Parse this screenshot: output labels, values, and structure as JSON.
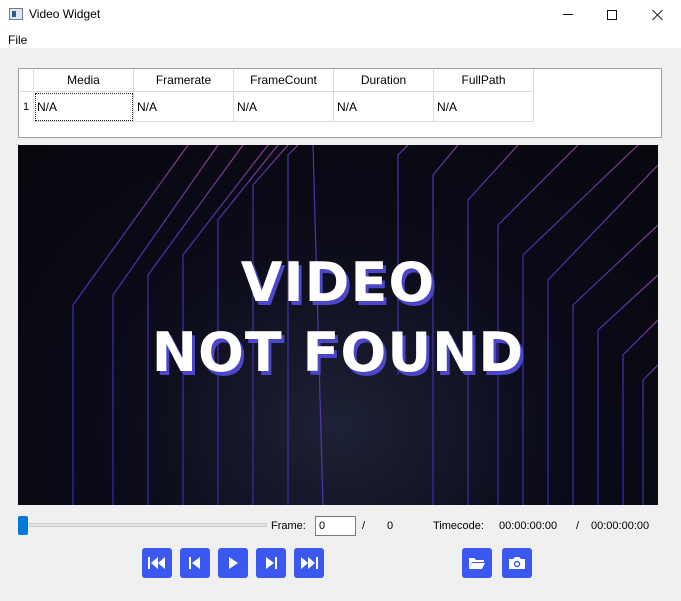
{
  "window": {
    "title": "Video Widget"
  },
  "menu": {
    "file": "File"
  },
  "table": {
    "headers": [
      "Media",
      "Framerate",
      "FrameCount",
      "Duration",
      "FullPath"
    ],
    "row_number": "1",
    "row": [
      "N/A",
      "N/A",
      "N/A",
      "N/A",
      "N/A"
    ]
  },
  "video": {
    "line1": "VIDEO",
    "line2": "NOT FOUND"
  },
  "controls": {
    "frame_label": "Frame:",
    "frame_value": "0",
    "frame_separator": "/",
    "frame_total": "0",
    "timecode_label": "Timecode:",
    "timecode_current": "00:00:00:00",
    "timecode_separator": "/",
    "timecode_total": "00:00:00:00",
    "seek_position": 0,
    "accent_color": "#3b59f0"
  },
  "icons": [
    "skip-to-start-icon",
    "step-back-icon",
    "play-icon",
    "step-forward-icon",
    "skip-to-end-icon",
    "open-folder-icon",
    "camera-icon"
  ]
}
